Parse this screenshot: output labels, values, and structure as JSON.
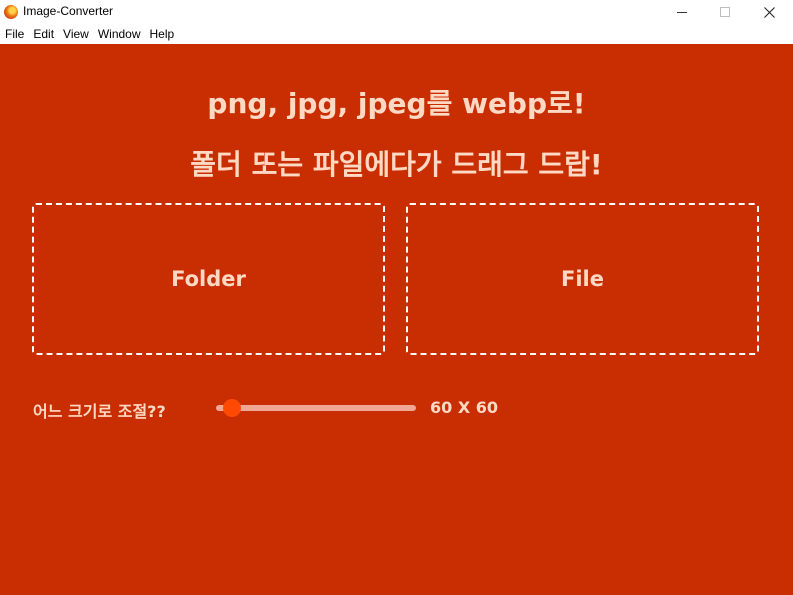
{
  "window": {
    "title": "Image-Converter",
    "icon": "firefox-like-app-icon"
  },
  "menu": [
    "File",
    "Edit",
    "View",
    "Window",
    "Help"
  ],
  "headline": {
    "line1": "png, jpg, jpeg를 webp로!",
    "line2": "폴더 또는 파일에다가 드래그 드랍!"
  },
  "dropzones": {
    "folder": "Folder",
    "file": "File"
  },
  "resize": {
    "label": "어느 크기로 조절??",
    "slider_level": 0.08,
    "readout": "60 X 60"
  },
  "colors": {
    "background": "#c92e02",
    "text": "#ffd9c4",
    "slider_track": "#f0a796",
    "slider_thumb": "#ff4a05",
    "dropzone_border": "#ffffff"
  }
}
